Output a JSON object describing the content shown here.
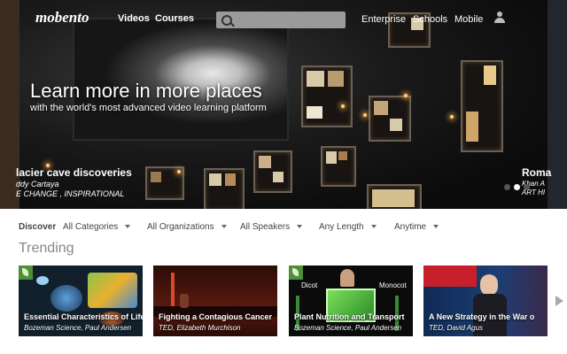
{
  "header": {
    "logo": "mobento",
    "nav": [
      "Videos",
      "Courses"
    ],
    "search_placeholder": "",
    "right_links": [
      "Enterprise",
      "Schools",
      "Mobile"
    ]
  },
  "hero": {
    "title": "Learn more in more places",
    "subtitle": "with the world's most advanced video learning platform",
    "left_caption": {
      "title": "lacier cave discoveries",
      "author": "ddy Cartaya",
      "tags": "E CHANGE , INSPIRATIONAL"
    },
    "right_caption": {
      "title": "Roma",
      "author": "Khan A",
      "tags": "ART HI"
    },
    "slide_count": 3,
    "active_slide": 2
  },
  "filters": {
    "label": "Discover",
    "items": [
      "All Categories",
      "All Organizations",
      "All Speakers",
      "Any Length",
      "Anytime"
    ]
  },
  "trending": {
    "heading": "Trending",
    "cards": [
      {
        "title": "Essential Characteristics of Life",
        "author": "Bozeman Science, Paul Andersen"
      },
      {
        "title": "Fighting a Contagious Cancer",
        "author": "TED, Elizabeth Murchison"
      },
      {
        "title": "Plant Nutrition and Transport",
        "author": "Bozeman Science, Paul Andersen",
        "labels": [
          "Dicot",
          "Monocot"
        ]
      },
      {
        "title": "A New Strategy in the War o",
        "author": "TED, David Agus"
      }
    ]
  },
  "colors": {
    "hero_background": "#101010",
    "page_background": "#ffffff",
    "badge_green": "#4f8f3a"
  }
}
